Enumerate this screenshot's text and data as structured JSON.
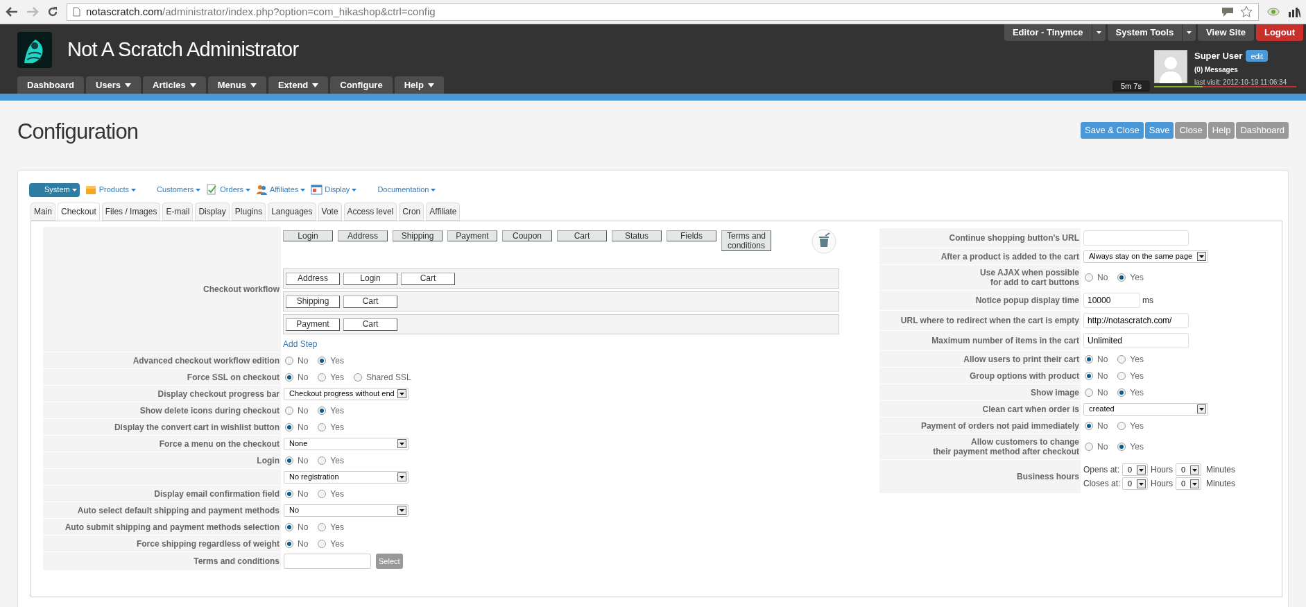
{
  "browser": {
    "url_host": "notascratch.com",
    "url_path": "/administrator/index.php?option=com_hikashop&ctrl=config"
  },
  "header": {
    "site_title": "Not A Scratch Administrator",
    "menu": [
      {
        "label": "Dashboard",
        "dropdown": false
      },
      {
        "label": "Users",
        "dropdown": true
      },
      {
        "label": "Articles",
        "dropdown": true
      },
      {
        "label": "Menus",
        "dropdown": true
      },
      {
        "label": "Extend",
        "dropdown": true
      },
      {
        "label": "Configure",
        "dropdown": false
      },
      {
        "label": "Help",
        "dropdown": true
      }
    ],
    "top_buttons": [
      {
        "label": "Editor - Tinymce",
        "dropdown": true,
        "kind": "default"
      },
      {
        "label": "System Tools",
        "dropdown": true,
        "kind": "default"
      },
      {
        "label": "View Site",
        "dropdown": false,
        "kind": "default"
      },
      {
        "label": "Logout",
        "dropdown": false,
        "kind": "danger"
      }
    ],
    "user": {
      "name": "Super User",
      "edit": "edit",
      "messages": "(0) Messages",
      "last_visit": "last visit: 2012-10-19 11:06:34"
    },
    "session_timer": "5m 7s"
  },
  "page_title": "Configuration",
  "toolbar": [
    {
      "label": "Save & Close",
      "kind": "primary"
    },
    {
      "label": "Save",
      "kind": "primary"
    },
    {
      "label": "Close",
      "kind": "default"
    },
    {
      "label": "Help",
      "kind": "default"
    },
    {
      "label": "Dashboard",
      "kind": "default"
    }
  ],
  "submenu": [
    {
      "label": "System",
      "selected": true,
      "icon": false
    },
    {
      "label": "Products",
      "selected": false,
      "icon": true
    },
    {
      "label": "Customers",
      "selected": false,
      "icon": false
    },
    {
      "label": "Orders",
      "selected": false,
      "icon": true
    },
    {
      "label": "Affiliates",
      "selected": false,
      "icon": true
    },
    {
      "label": "Display",
      "selected": false,
      "icon": true
    },
    {
      "label": "Documentation",
      "selected": false,
      "icon": false
    }
  ],
  "tabs": [
    {
      "label": "Main",
      "selected": false
    },
    {
      "label": "Checkout",
      "selected": true
    },
    {
      "label": "Files / Images",
      "selected": false
    },
    {
      "label": "E-mail",
      "selected": false
    },
    {
      "label": "Display",
      "selected": false
    },
    {
      "label": "Plugins",
      "selected": false
    },
    {
      "label": "Languages",
      "selected": false
    },
    {
      "label": "Vote",
      "selected": false
    },
    {
      "label": "Access level",
      "selected": false
    },
    {
      "label": "Cron",
      "selected": false
    },
    {
      "label": "Affiliate",
      "selected": false
    }
  ],
  "checkout_workflow": {
    "label": "Checkout workflow",
    "palette": [
      "Login",
      "Address",
      "Shipping",
      "Payment",
      "Coupon",
      "Cart",
      "Status",
      "Fields",
      "Terms and conditions"
    ],
    "steps": [
      [
        "Address",
        "Login",
        "Cart"
      ],
      [
        "Shipping",
        "Cart"
      ],
      [
        "Payment",
        "Cart"
      ]
    ],
    "add_step": "Add Step"
  },
  "left_fields": [
    {
      "label": "Advanced checkout workflow edition",
      "kind": "radio",
      "options": [
        {
          "label": "No",
          "selected": false
        },
        {
          "label": "Yes",
          "selected": true
        }
      ]
    },
    {
      "label": "Force SSL on checkout",
      "kind": "radio",
      "options": [
        {
          "label": "No",
          "selected": true
        },
        {
          "label": "Yes",
          "selected": false
        },
        {
          "label": "Shared SSL",
          "selected": false
        }
      ]
    },
    {
      "label": "Display checkout progress bar",
      "kind": "select",
      "value": "Checkout progress without end"
    },
    {
      "label": "Show delete icons during checkout",
      "kind": "radio",
      "options": [
        {
          "label": "No",
          "selected": false
        },
        {
          "label": "Yes",
          "selected": true
        }
      ]
    },
    {
      "label": "Display the convert cart in wishlist button",
      "kind": "radio",
      "options": [
        {
          "label": "No",
          "selected": true
        },
        {
          "label": "Yes",
          "selected": false
        }
      ]
    },
    {
      "label": "Force a menu on the checkout",
      "kind": "select",
      "value": "None"
    },
    {
      "label": "Login",
      "kind": "radio",
      "options": [
        {
          "label": "No",
          "selected": true
        },
        {
          "label": "Yes",
          "selected": false
        }
      ]
    },
    {
      "kind": "select",
      "value": "No registration"
    },
    {
      "label": "Display email confirmation field",
      "kind": "radio",
      "options": [
        {
          "label": "No",
          "selected": true
        },
        {
          "label": "Yes",
          "selected": false
        }
      ]
    },
    {
      "label": "Auto select default shipping and payment methods",
      "kind": "select",
      "value": "No"
    },
    {
      "label": "Auto submit shipping and payment methods selection",
      "kind": "radio",
      "options": [
        {
          "label": "No",
          "selected": true
        },
        {
          "label": "Yes",
          "selected": false
        }
      ]
    },
    {
      "label": "Force shipping regardless of weight",
      "kind": "radio",
      "options": [
        {
          "label": "No",
          "selected": true
        },
        {
          "label": "Yes",
          "selected": false
        }
      ]
    },
    {
      "label": "Terms and conditions",
      "kind": "picker",
      "button": "Select"
    }
  ],
  "right_fields": [
    {
      "label": "Continue shopping button's URL",
      "kind": "text"
    },
    {
      "label": "After a product is added to the cart",
      "kind": "select",
      "value": "Always stay on the same page"
    },
    {
      "label": "Use AJAX when possible\nfor add to cart buttons",
      "kind": "radio",
      "options": [
        {
          "label": "No",
          "selected": false
        },
        {
          "label": "Yes",
          "selected": true
        }
      ]
    },
    {
      "label": "Notice popup display time",
      "kind": "text",
      "value": "10000",
      "unit": "ms"
    },
    {
      "label": "URL where to redirect when the cart is empty",
      "kind": "text",
      "value": "http://notascratch.com/"
    },
    {
      "label": "Maximum number of items in the cart",
      "kind": "text",
      "value": "Unlimited"
    },
    {
      "label": "Allow users to print their cart",
      "kind": "radio",
      "options": [
        {
          "label": "No",
          "selected": true
        },
        {
          "label": "Yes",
          "selected": false
        }
      ]
    },
    {
      "label": "Group options with product",
      "kind": "radio",
      "options": [
        {
          "label": "No",
          "selected": true
        },
        {
          "label": "Yes",
          "selected": false
        }
      ]
    },
    {
      "label": "Show image",
      "kind": "radio",
      "options": [
        {
          "label": "No",
          "selected": false
        },
        {
          "label": "Yes",
          "selected": true
        }
      ]
    },
    {
      "label": "Clean cart when order is",
      "kind": "select",
      "value": "created"
    },
    {
      "label": "Payment of orders not paid immediately",
      "kind": "radio",
      "options": [
        {
          "label": "No",
          "selected": true
        },
        {
          "label": "Yes",
          "selected": false
        }
      ]
    },
    {
      "label": "Allow customers to change\ntheir payment method after checkout",
      "kind": "radio",
      "options": [
        {
          "label": "No",
          "selected": false
        },
        {
          "label": "Yes",
          "selected": true
        }
      ]
    },
    {
      "label": "Business hours",
      "kind": "hours",
      "lines": [
        {
          "label": "Opens at:",
          "hours": "0",
          "hours_label": "Hours",
          "minutes": "0",
          "minutes_label": "Minutes"
        },
        {
          "label": "Closes at:",
          "hours": "0",
          "hours_label": "Hours",
          "minutes": "0",
          "minutes_label": "Minutes"
        }
      ]
    }
  ]
}
